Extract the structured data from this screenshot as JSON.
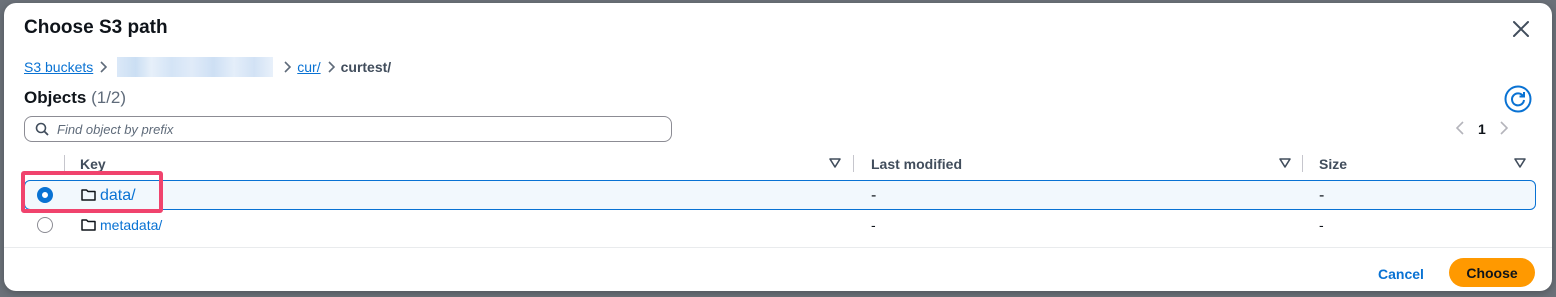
{
  "modal": {
    "title": "Choose S3 path"
  },
  "breadcrumb": {
    "root": "S3 buckets",
    "cur": "cur/",
    "current": "curtest/"
  },
  "objects": {
    "label": "Objects",
    "count": "(1/2)"
  },
  "search": {
    "placeholder": "Find object by prefix",
    "value": ""
  },
  "pagination": {
    "page": "1"
  },
  "table": {
    "columns": [
      "Key",
      "Last modified",
      "Size"
    ],
    "rows": [
      {
        "key": "data/",
        "last_modified": "-",
        "size": "-",
        "selected": true
      },
      {
        "key": "metadata/",
        "last_modified": "-",
        "size": "-",
        "selected": false
      }
    ]
  },
  "footer": {
    "cancel_label": "Cancel",
    "choose_label": "Choose"
  },
  "colors": {
    "accent": "#0972d3",
    "primary_button": "#ff9900",
    "highlight": "#f0436d"
  },
  "icons": [
    "close-icon",
    "chevron-right-icon",
    "refresh-icon",
    "search-icon",
    "chevron-left-icon",
    "sort-down-icon",
    "folder-icon"
  ]
}
